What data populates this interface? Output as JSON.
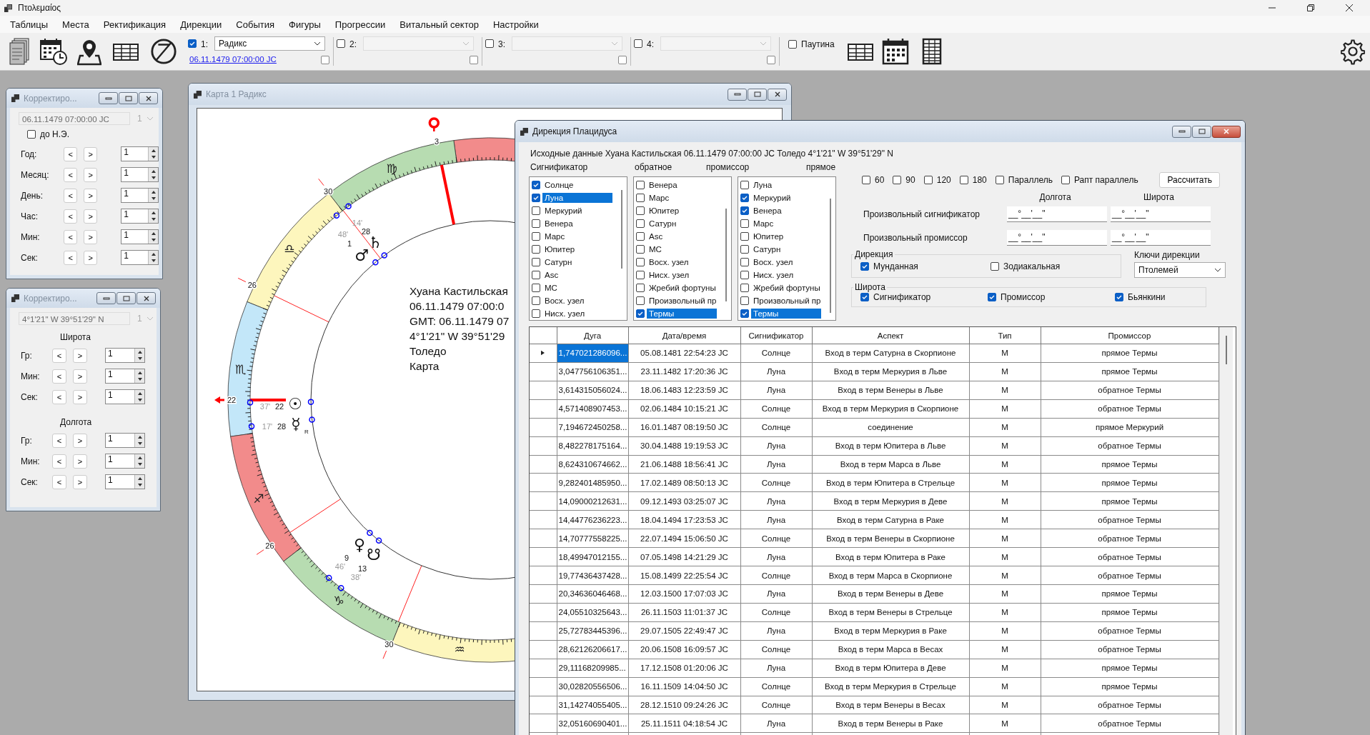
{
  "app": {
    "title": "Πτολεμαίος"
  },
  "menu": [
    "Таблицы",
    "Места",
    "Ректификация",
    "Дирекции",
    "События",
    "Фигуры",
    "Прогрессии",
    "Витальный сектор",
    "Настройки"
  ],
  "toolbar": {
    "slots": [
      {
        "number": "1:",
        "checked": true,
        "enabled": true,
        "value": "Радикс",
        "date": "06.11.1479 07:00:00 JC",
        "sub_checked": false
      },
      {
        "number": "2:",
        "checked": false,
        "enabled": false,
        "sub_checked": false
      },
      {
        "number": "3:",
        "checked": false,
        "enabled": false,
        "sub_checked": false
      },
      {
        "number": "4:",
        "checked": false,
        "enabled": false,
        "sub_checked": false
      }
    ],
    "web": {
      "label": "Паутина",
      "checked": false
    }
  },
  "date_window": {
    "title": "Корректиро...",
    "value": "06.11.1479 07:00:00 JC",
    "combo": "1",
    "bc": {
      "label": "до Н.Э.",
      "checked": false
    },
    "rows": [
      {
        "label": "Год:",
        "prev": "<",
        "next": ">",
        "value": "1"
      },
      {
        "label": "Месяц:",
        "prev": "<",
        "next": ">",
        "value": "1"
      },
      {
        "label": "День:",
        "prev": "<",
        "next": ">",
        "value": "1"
      },
      {
        "label": "Час:",
        "prev": "<",
        "next": ">",
        "value": "1"
      },
      {
        "label": "Мин:",
        "prev": "<",
        "next": ">",
        "value": "1"
      },
      {
        "label": "Сек:",
        "prev": "<",
        "next": ">",
        "value": "1"
      }
    ]
  },
  "place_window": {
    "title": "Корректиро...",
    "value": "4°1'21\" W 39°51'29\" N",
    "combo": "1",
    "sections": [
      {
        "heading": "Широта",
        "rows": [
          {
            "label": "Гр:",
            "prev": "<",
            "next": ">",
            "value": "1"
          },
          {
            "label": "Мин:",
            "prev": "<",
            "next": ">",
            "value": "1"
          },
          {
            "label": "Сек:",
            "prev": "<",
            "next": ">",
            "value": "1"
          }
        ]
      },
      {
        "heading": "Долгота",
        "rows": [
          {
            "label": "Гр:",
            "prev": "<",
            "next": ">",
            "value": "1"
          },
          {
            "label": "Мин:",
            "prev": "<",
            "next": ">",
            "value": "1"
          },
          {
            "label": "Сек:",
            "prev": "<",
            "next": ">",
            "value": "1"
          }
        ]
      }
    ]
  },
  "chart_window": {
    "title": "Карта 1 Радикс",
    "info": [
      "Хуана Кастильская",
      "06.11.1479 07:00:0",
      "GMT: 06.11.1479 07",
      "4°1'21\" W 39°51'29",
      "Толедо",
      "Карта"
    ],
    "signs": [
      {
        "color": "#f28b8b"
      },
      {
        "glyph": "♍",
        "color": "#b7dcb1"
      },
      {
        "glyph": "♎",
        "color": "#fdf6bd"
      },
      {
        "glyph": "♏",
        "color": "#c3e7f9"
      },
      {
        "glyph": "♐",
        "color": "#f28b8b"
      },
      {
        "glyph": "♑",
        "color": "#b7dcb1"
      },
      {
        "glyph": "♒",
        "color": "#fdf6bd"
      }
    ],
    "cusps": [
      {
        "label": "3",
        "kind": "mc"
      },
      {
        "label": "30",
        "kind": "cusp"
      },
      {
        "label": "26",
        "kind": "cusp"
      },
      {
        "label": "22",
        "kind": "asc"
      },
      {
        "label": "26",
        "kind": "cusp"
      },
      {
        "label": "30",
        "kind": "cusp"
      }
    ],
    "planets": [
      {
        "glyph": "♄",
        "degree": "28",
        "minutes": "14'"
      },
      {
        "glyph": "♂",
        "degree": "1",
        "minutes": "48'"
      },
      {
        "glyph": "☉",
        "degree": "22",
        "minutes": "37'"
      },
      {
        "glyph": "☿",
        "degree": "28",
        "minutes": "17'",
        "note": "R"
      },
      {
        "glyph": "♀",
        "degree": "9",
        "minutes": "46'"
      },
      {
        "glyph": "☋",
        "degree": "13",
        "minutes": "38'"
      }
    ]
  },
  "direction_window": {
    "title": "Дирекция Плацидуса",
    "source": "Исходные данные Хуана Кастильская 06.11.1479 07:00:00 JC Толедо 4°1'21\" W 39°51'29\" N",
    "list_headings": [
      "Сигнификатор",
      "обратное",
      "промиссор",
      "прямое"
    ],
    "lists": [
      [
        {
          "label": "Солнце",
          "checked": true,
          "selected": false
        },
        {
          "label": "Луна",
          "checked": true,
          "selected": true
        },
        {
          "label": "Меркурий",
          "checked": false,
          "selected": false
        },
        {
          "label": "Венера",
          "checked": false,
          "selected": false
        },
        {
          "label": "Марс",
          "checked": false,
          "selected": false
        },
        {
          "label": "Юпитер",
          "checked": false,
          "selected": false
        },
        {
          "label": "Сатурн",
          "checked": false,
          "selected": false
        },
        {
          "label": "Asc",
          "checked": false,
          "selected": false
        },
        {
          "label": "MC",
          "checked": false,
          "selected": false
        },
        {
          "label": "Восх. узел",
          "checked": false,
          "selected": false
        },
        {
          "label": "Нисх. узел",
          "checked": false,
          "selected": false
        }
      ],
      [
        {
          "label": "Венера",
          "checked": false,
          "selected": false
        },
        {
          "label": "Марс",
          "checked": false,
          "selected": false
        },
        {
          "label": "Юпитер",
          "checked": false,
          "selected": false
        },
        {
          "label": "Сатурн",
          "checked": false,
          "selected": false
        },
        {
          "label": "Asc",
          "checked": false,
          "selected": false
        },
        {
          "label": "MC",
          "checked": false,
          "selected": false
        },
        {
          "label": "Восх. узел",
          "checked": false,
          "selected": false
        },
        {
          "label": "Нисх. узел",
          "checked": false,
          "selected": false
        },
        {
          "label": "Жребий фортуны",
          "checked": false,
          "selected": false
        },
        {
          "label": "Произвольный пр",
          "checked": false,
          "selected": false
        },
        {
          "label": "Термы",
          "checked": true,
          "selected": true
        }
      ],
      [
        {
          "label": "Луна",
          "checked": false,
          "selected": false
        },
        {
          "label": "Меркурий",
          "checked": true,
          "selected": false
        },
        {
          "label": "Венера",
          "checked": true,
          "selected": false
        },
        {
          "label": "Марс",
          "checked": false,
          "selected": false
        },
        {
          "label": "Юпитер",
          "checked": false,
          "selected": false
        },
        {
          "label": "Сатурн",
          "checked": false,
          "selected": false
        },
        {
          "label": "Восх. узел",
          "checked": false,
          "selected": false
        },
        {
          "label": "Нисх. узел",
          "checked": false,
          "selected": false
        },
        {
          "label": "Жребий фортуны",
          "checked": false,
          "selected": false
        },
        {
          "label": "Произвольный пр",
          "checked": false,
          "selected": false
        },
        {
          "label": "Термы",
          "checked": true,
          "selected": true
        }
      ]
    ],
    "aspects": [
      {
        "label": "60",
        "checked": false
      },
      {
        "label": "90",
        "checked": false
      },
      {
        "label": "120",
        "checked": false
      },
      {
        "label": "180",
        "checked": false
      },
      {
        "label": "Параллель",
        "checked": false
      },
      {
        "label": "Рапт параллель",
        "checked": false
      }
    ],
    "calc_button": "Рассчитать",
    "coord_headings": [
      "Долгота",
      "Широта"
    ],
    "arbitrary": [
      {
        "label": "Произвольный сигнификатор",
        "fields": [
          "__°__'__\"",
          "__°__'__\""
        ]
      },
      {
        "label": "Произвольный промиссор",
        "fields": [
          "__°__'__\"",
          "__°__'__\""
        ]
      }
    ],
    "direction_group": {
      "title": "Дирекция",
      "options": [
        {
          "label": "Мунданная",
          "checked": true
        },
        {
          "label": "Зодиакальная",
          "checked": false
        }
      ]
    },
    "keys": {
      "label": "Ключи дирекции",
      "value": "Птолемей"
    },
    "latitude_group": {
      "title": "Широта",
      "options": [
        {
          "label": "Сигнификатор",
          "checked": true
        },
        {
          "label": "Промиссор",
          "checked": true
        },
        {
          "label": "Бьянкини",
          "checked": true
        }
      ]
    },
    "table": {
      "columns": [
        "Дуга",
        "Дата/время",
        "Сигнификатор",
        "Аспект",
        "Тип",
        "Промиссор"
      ],
      "rows": [
        {
          "selected": true,
          "cells": [
            "1,747021286096...",
            "05.08.1481 22:54:23 JC",
            "Солнце",
            "Вход в терм Сатурна в Скорпионе",
            "М",
            "прямое Термы"
          ]
        },
        {
          "selected": false,
          "cells": [
            "3,047756106351...",
            "23.11.1482 17:20:36 JC",
            "Луна",
            "Вход в терм Меркурия в Льве",
            "М",
            "прямое Термы"
          ]
        },
        {
          "selected": false,
          "cells": [
            "3,614315056024...",
            "18.06.1483 12:23:59 JC",
            "Луна",
            "Вход в терм Венеры в Льве",
            "М",
            "обратное Термы"
          ]
        },
        {
          "selected": false,
          "cells": [
            "4,571408907453...",
            "02.06.1484 10:15:21 JC",
            "Солнце",
            "Вход в терм Меркурия в Скорпионе",
            "М",
            "обратное Термы"
          ]
        },
        {
          "selected": false,
          "cells": [
            "7,194672450258...",
            "16.01.1487 08:19:50 JC",
            "Солнце",
            "соединение",
            "М",
            "прямое Меркурий"
          ]
        },
        {
          "selected": false,
          "cells": [
            "8,482278175164...",
            "30.04.1488 19:19:53 JC",
            "Луна",
            "Вход в терм Юпитера в Льве",
            "М",
            "обратное Термы"
          ]
        },
        {
          "selected": false,
          "cells": [
            "8,624310674662...",
            "21.06.1488 18:56:41 JC",
            "Луна",
            "Вход в терм Марса в Льве",
            "М",
            "прямое Термы"
          ]
        },
        {
          "selected": false,
          "cells": [
            "9,282401485950...",
            "17.02.1489 08:50:13 JC",
            "Солнце",
            "Вход в терм Юпитера в Стрельце",
            "М",
            "прямое Термы"
          ]
        },
        {
          "selected": false,
          "cells": [
            "14,09000212631...",
            "09.12.1493 03:25:07 JC",
            "Луна",
            "Вход в терм Меркурия в Деве",
            "М",
            "прямое Термы"
          ]
        },
        {
          "selected": false,
          "cells": [
            "14,44776236223...",
            "18.04.1494 17:23:53 JC",
            "Луна",
            "Вход в терм Сатурна в Раке",
            "М",
            "обратное Термы"
          ]
        },
        {
          "selected": false,
          "cells": [
            "14,70777558225...",
            "22.07.1494 15:06:50 JC",
            "Солнце",
            "Вход в терм Венеры в Скорпионе",
            "М",
            "обратное Термы"
          ]
        },
        {
          "selected": false,
          "cells": [
            "18,49947012155...",
            "07.05.1498 14:21:29 JC",
            "Луна",
            "Вход в терм Юпитера в Раке",
            "М",
            "обратное Термы"
          ]
        },
        {
          "selected": false,
          "cells": [
            "19,77436437428...",
            "15.08.1499 22:25:54 JC",
            "Солнце",
            "Вход в терм Марса в Скорпионе",
            "М",
            "обратное Термы"
          ]
        },
        {
          "selected": false,
          "cells": [
            "20,34636046468...",
            "12.03.1500 17:07:03 JC",
            "Луна",
            "Вход в терм Венеры в Деве",
            "М",
            "прямое Термы"
          ]
        },
        {
          "selected": false,
          "cells": [
            "24,05510325643...",
            "26.11.1503 11:01:37 JC",
            "Солнце",
            "Вход в терм Венеры в Стрельце",
            "М",
            "прямое Термы"
          ]
        },
        {
          "selected": false,
          "cells": [
            "25,72783445396...",
            "29.07.1505 22:49:47 JC",
            "Луна",
            "Вход в терм Меркурия в Раке",
            "М",
            "обратное Термы"
          ]
        },
        {
          "selected": false,
          "cells": [
            "28,62126206617...",
            "20.06.1508 16:09:57 JC",
            "Солнце",
            "Вход в терм Марса в Весах",
            "М",
            "обратное Термы"
          ]
        },
        {
          "selected": false,
          "cells": [
            "29,11168209985...",
            "17.12.1508 01:20:06 JC",
            "Луна",
            "Вход в терм Юпитера в Деве",
            "М",
            "прямое Термы"
          ]
        },
        {
          "selected": false,
          "cells": [
            "30,02820556506...",
            "16.11.1509 14:04:50 JC",
            "Солнце",
            "Вход в терм Меркурия в Стрельце",
            "М",
            "прямое Термы"
          ]
        },
        {
          "selected": false,
          "cells": [
            "31,14274055405...",
            "28.12.1510 09:24:26 JC",
            "Солнце",
            "Вход в терм Венеры в Весах",
            "М",
            "обратное Термы"
          ]
        },
        {
          "selected": false,
          "cells": [
            "32,05160690401...",
            "25.11.1511 04:18:54 JC",
            "Луна",
            "Вход в терм Венеры в Раке",
            "М",
            "обратное Термы"
          ]
        }
      ]
    }
  }
}
